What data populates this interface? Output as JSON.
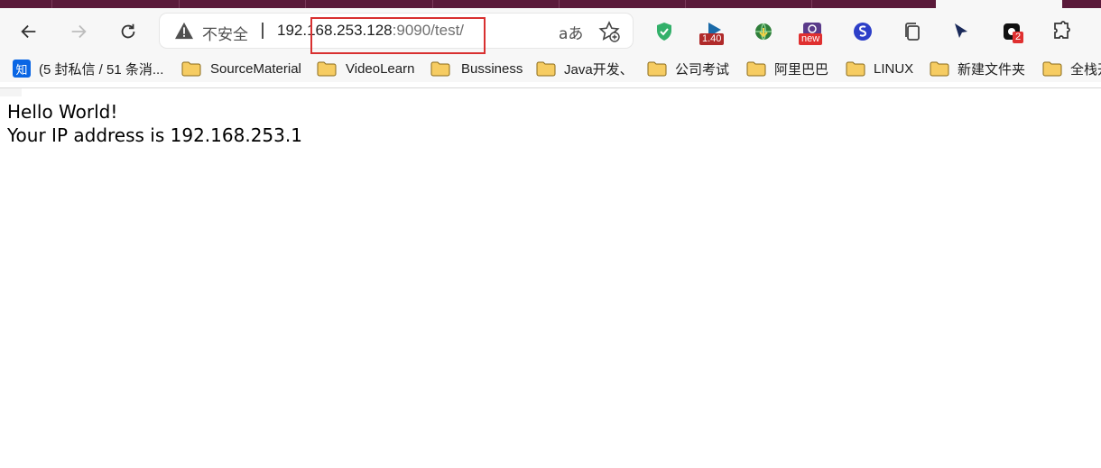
{
  "toolbar": {
    "security_label": "不安全",
    "url_host_part1": "192.1",
    "url_host_part2": "68.253.128",
    "url_rest": ":9090/test/",
    "read_aloud": "aあ"
  },
  "extensions": {
    "ext2_badge": "1.40",
    "ext4_badge": "new",
    "ext9_badge": "2"
  },
  "bookmarks": [
    {
      "label": "(5 封私信 / 51 条消..."
    },
    {
      "label": "SourceMaterial"
    },
    {
      "label": "VideoLearn"
    },
    {
      "label": "Bussiness"
    },
    {
      "label": "Java开发、"
    },
    {
      "label": "公司考试"
    },
    {
      "label": "阿里巴巴"
    },
    {
      "label": "LINUX"
    },
    {
      "label": "新建文件夹"
    },
    {
      "label": "全栈开"
    }
  ],
  "zhihu_icon_text": "知",
  "page": {
    "line1": "Hello World!",
    "line2": "Your IP address is 192.168.253.1"
  },
  "colors": {
    "tab_strip": "#5a1a3a",
    "highlight_box": "#d83030",
    "folder": "#f6cc62"
  }
}
